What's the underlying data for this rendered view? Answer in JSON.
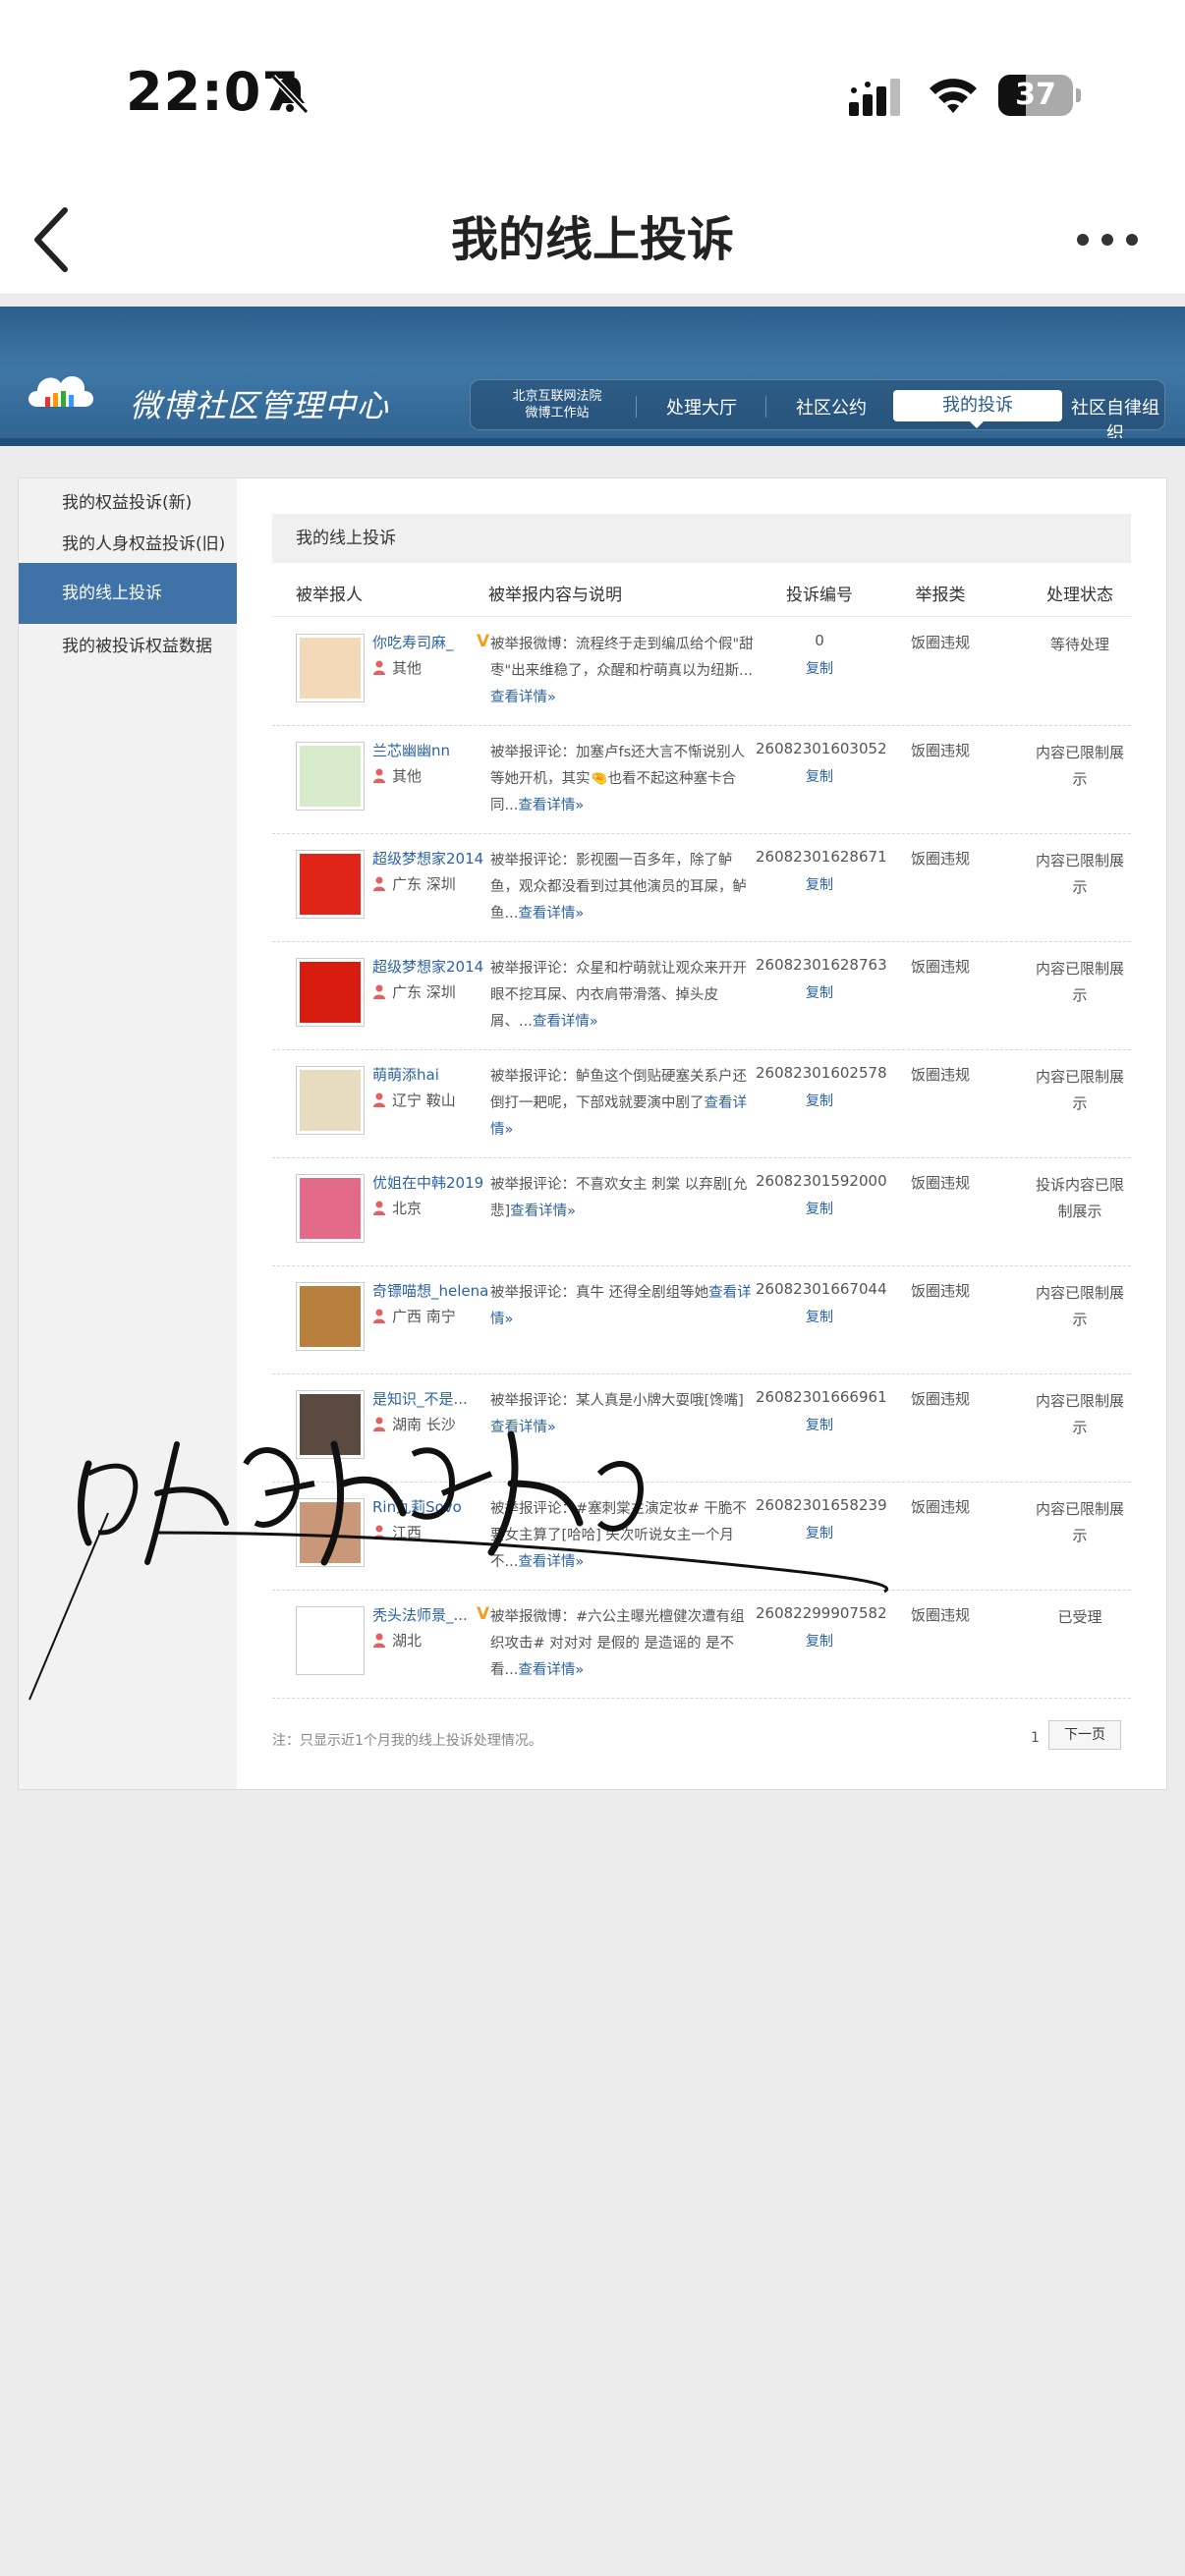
{
  "status_bar": {
    "time": "22:07",
    "battery": "37",
    "battery_level": 0.37
  },
  "nav": {
    "title": "我的线上投诉"
  },
  "site": {
    "title": "微博社区管理中心",
    "court_link": [
      "北京互联网法院",
      "微博工作站"
    ],
    "tabs": [
      "处理大厅",
      "社区公约",
      "我的投诉",
      "社区自律组织"
    ],
    "active_tab": "我的投诉"
  },
  "sidebar": {
    "items": [
      "我的权益投诉(新)",
      "我的人身权益投诉(旧)",
      "我的线上投诉",
      "我的被投诉权益数据"
    ],
    "active": "我的线上投诉"
  },
  "content": {
    "heading": "我的线上投诉",
    "columns": [
      "被举报人",
      "被举报内容与说明",
      "投诉编号",
      "举报类",
      "处理状态"
    ],
    "rows": [
      {
        "user": "你吃寿司麻_",
        "verified": true,
        "location": "其他",
        "desc": "被举报微博：流程终于走到编瓜给个假\"甜枣\"出来维稳了，众醒和柠萌真以为纽斯...",
        "more": "查看详情»",
        "id": "0",
        "copy": "复制",
        "type": "饭圈违规",
        "status": "等待处理"
      },
      {
        "user": "兰芯幽幽nn",
        "verified": false,
        "location": "其他",
        "desc": "被举报评论：加塞卢fs还大言不惭说别人等她开机，其实🤏也看不起这种塞卡合同...",
        "more": "查看详情»",
        "id": "26082301603052",
        "copy": "复制",
        "type": "饭圈违规",
        "status": "内容已限制展示"
      },
      {
        "user": "超级梦想家2014",
        "verified": false,
        "location": "广东 深圳",
        "desc": "被举报评论：影视圈一百多年，除了鲈鱼，观众都没看到过其他演员的耳屎，鲈鱼...",
        "more": "查看详情»",
        "id": "26082301628671",
        "copy": "复制",
        "type": "饭圈违规",
        "status": "内容已限制展示"
      },
      {
        "user": "超级梦想家2014",
        "verified": false,
        "location": "广东 深圳",
        "desc": "被举报评论：众星和柠萌就让观众来开开眼不挖耳屎、内衣肩带滑落、掉头皮屑、...",
        "more": "查看详情»",
        "id": "26082301628763",
        "copy": "复制",
        "type": "饭圈违规",
        "status": "内容已限制展示"
      },
      {
        "user": "萌萌添hai",
        "verified": false,
        "location": "辽宁 鞍山",
        "desc": "被举报评论：鲈鱼这个倒贴硬塞关系户还倒打一耙呢，下部戏就要演中剧了",
        "more": "查看详情»",
        "id": "26082301602578",
        "copy": "复制",
        "type": "饭圈违规",
        "status": "内容已限制展示"
      },
      {
        "user": "优姐在中韩2019",
        "verified": false,
        "location": "北京",
        "desc": "被举报评论：不喜欢女主 刺棠 以弃剧[允悲]",
        "more": "查看详情»",
        "id": "26082301592000",
        "copy": "复制",
        "type": "饭圈违规",
        "status": "投诉内容已限制展示"
      },
      {
        "user": "奇镖喵想_helena",
        "verified": false,
        "location": "广西 南宁",
        "desc": "被举报评论：真牛 还得全剧组等她",
        "more": "查看详情»",
        "id": "26082301667044",
        "copy": "复制",
        "type": "饭圈违规",
        "status": "内容已限制展示"
      },
      {
        "user": "是知识_不是...",
        "verified": false,
        "location": "湖南 长沙",
        "desc": "被举报评论：某人真是小牌大耍哦[馋嘴]",
        "more": "查看详情»",
        "id": "26082301666961",
        "copy": "复制",
        "type": "饭圈违规",
        "status": "内容已限制展示"
      },
      {
        "user": "Rin九莉Sovo",
        "verified": false,
        "location": "江西",
        "desc": "被举报评论：#塞刺棠主演定妆# 干脆不要女主算了[哈哈] 失次听说女主一个月不...",
        "more": "查看详情»",
        "id": "26082301658239",
        "copy": "复制",
        "type": "饭圈违规",
        "status": "内容已限制展示"
      },
      {
        "user": "秃头法师景_...",
        "verified": true,
        "location": "湖北",
        "desc": "被举报微博：#六公主曝光檀健次遭有组织攻击# 对对对 是假的 是造谣的 是不看...",
        "more": "查看详情»",
        "id": "26082299907582",
        "copy": "复制",
        "type": "饭圈违规",
        "status": "已受理"
      }
    ]
  },
  "footer": {
    "note": "注：只显示近1个月我的线上投诉处理情况。",
    "page": "1",
    "next": "下一页"
  },
  "signature_text": "晓悟心天成"
}
